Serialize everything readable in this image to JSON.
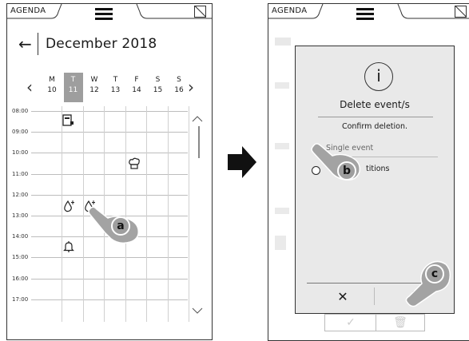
{
  "left_screen": {
    "status": {
      "title": "AGENDA",
      "menu_icon": "hamburger-menu-icon",
      "window_icon": "window-toggle-icon"
    },
    "header": {
      "back_icon": "arrow-left-icon",
      "month": "December 2018"
    },
    "week": {
      "prev_icon": "chevron-left-icon",
      "next_icon": "chevron-right-icon",
      "days": [
        {
          "letter": "M",
          "num": "10",
          "selected": false
        },
        {
          "letter": "T",
          "num": "11",
          "selected": true
        },
        {
          "letter": "W",
          "num": "12",
          "selected": false
        },
        {
          "letter": "T",
          "num": "13",
          "selected": false
        },
        {
          "letter": "F",
          "num": "14",
          "selected": false
        },
        {
          "letter": "S",
          "num": "15",
          "selected": false
        },
        {
          "letter": "S",
          "num": "16",
          "selected": false
        }
      ]
    },
    "hours": [
      "08:00",
      "09:00",
      "10:00",
      "11:00",
      "12:00",
      "13:00",
      "14:00",
      "15:00",
      "16:00",
      "17:00"
    ],
    "events": [
      {
        "icon": "oven-program-icon",
        "glyph": "▣"
      },
      {
        "icon": "chef-hat-icon",
        "glyph": "♔"
      },
      {
        "icon": "water-drop-plus-icon",
        "glyph": "💧"
      },
      {
        "icon": "water-drop-plus-icon",
        "glyph": "💧"
      },
      {
        "icon": "bell-icon",
        "glyph": "🔔"
      }
    ],
    "callout": "a"
  },
  "right_screen": {
    "status": {
      "title": "AGENDA",
      "menu_icon": "hamburger-menu-icon",
      "window_icon": "window-toggle-icon"
    },
    "dialog": {
      "icon": "info-icon",
      "icon_glyph": "i",
      "title": "Delete event/s",
      "subtitle": "Confirm deletion.",
      "options": [
        {
          "label": "Single event",
          "selected": true
        },
        {
          "label": "titions",
          "selected": false
        }
      ],
      "cancel_glyph": "✕",
      "confirm_glyph": "✓"
    },
    "callouts": [
      "b",
      "c"
    ],
    "background_buttons": {
      "check_glyph": "✓",
      "trash_glyph": "🗑"
    }
  }
}
